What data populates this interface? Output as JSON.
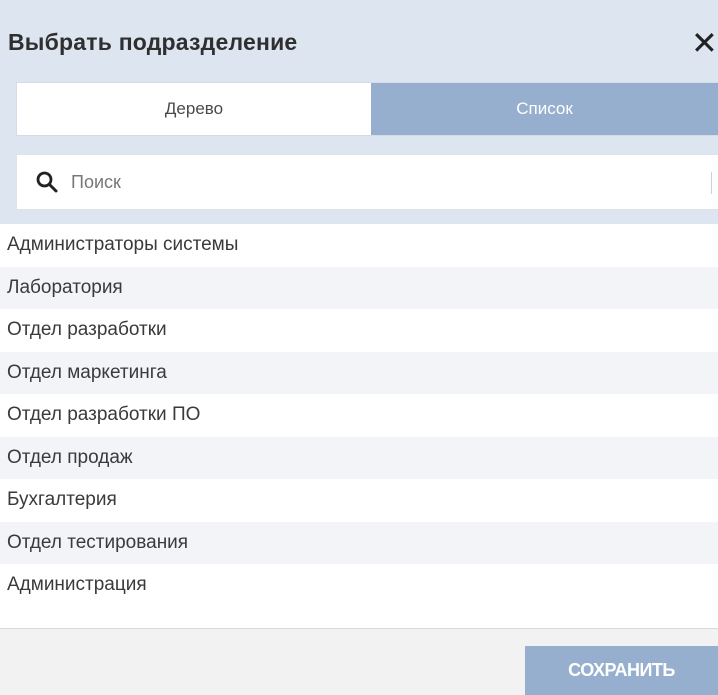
{
  "dialog": {
    "title": "Выбрать подразделение",
    "close_symbol": "✕"
  },
  "tabs": [
    {
      "label": "Дерево",
      "active": false
    },
    {
      "label": "Список",
      "active": true
    }
  ],
  "search": {
    "icon": "search-icon",
    "value": "",
    "placeholder": "Поиск"
  },
  "list": {
    "items": [
      "Администраторы системы",
      "Лаборатория",
      "Отдел разработки",
      "Отдел маркетинга",
      "Отдел разработки ПО",
      "Отдел продаж",
      "Бухгалтерия",
      "Отдел тестирования",
      "Администрация"
    ]
  },
  "footer": {
    "save_label": "СОХРАНИТЬ"
  },
  "colors": {
    "accent": "#97afcf",
    "header_bg": "#dde6f0",
    "row_alt": "#f2f4f8"
  }
}
